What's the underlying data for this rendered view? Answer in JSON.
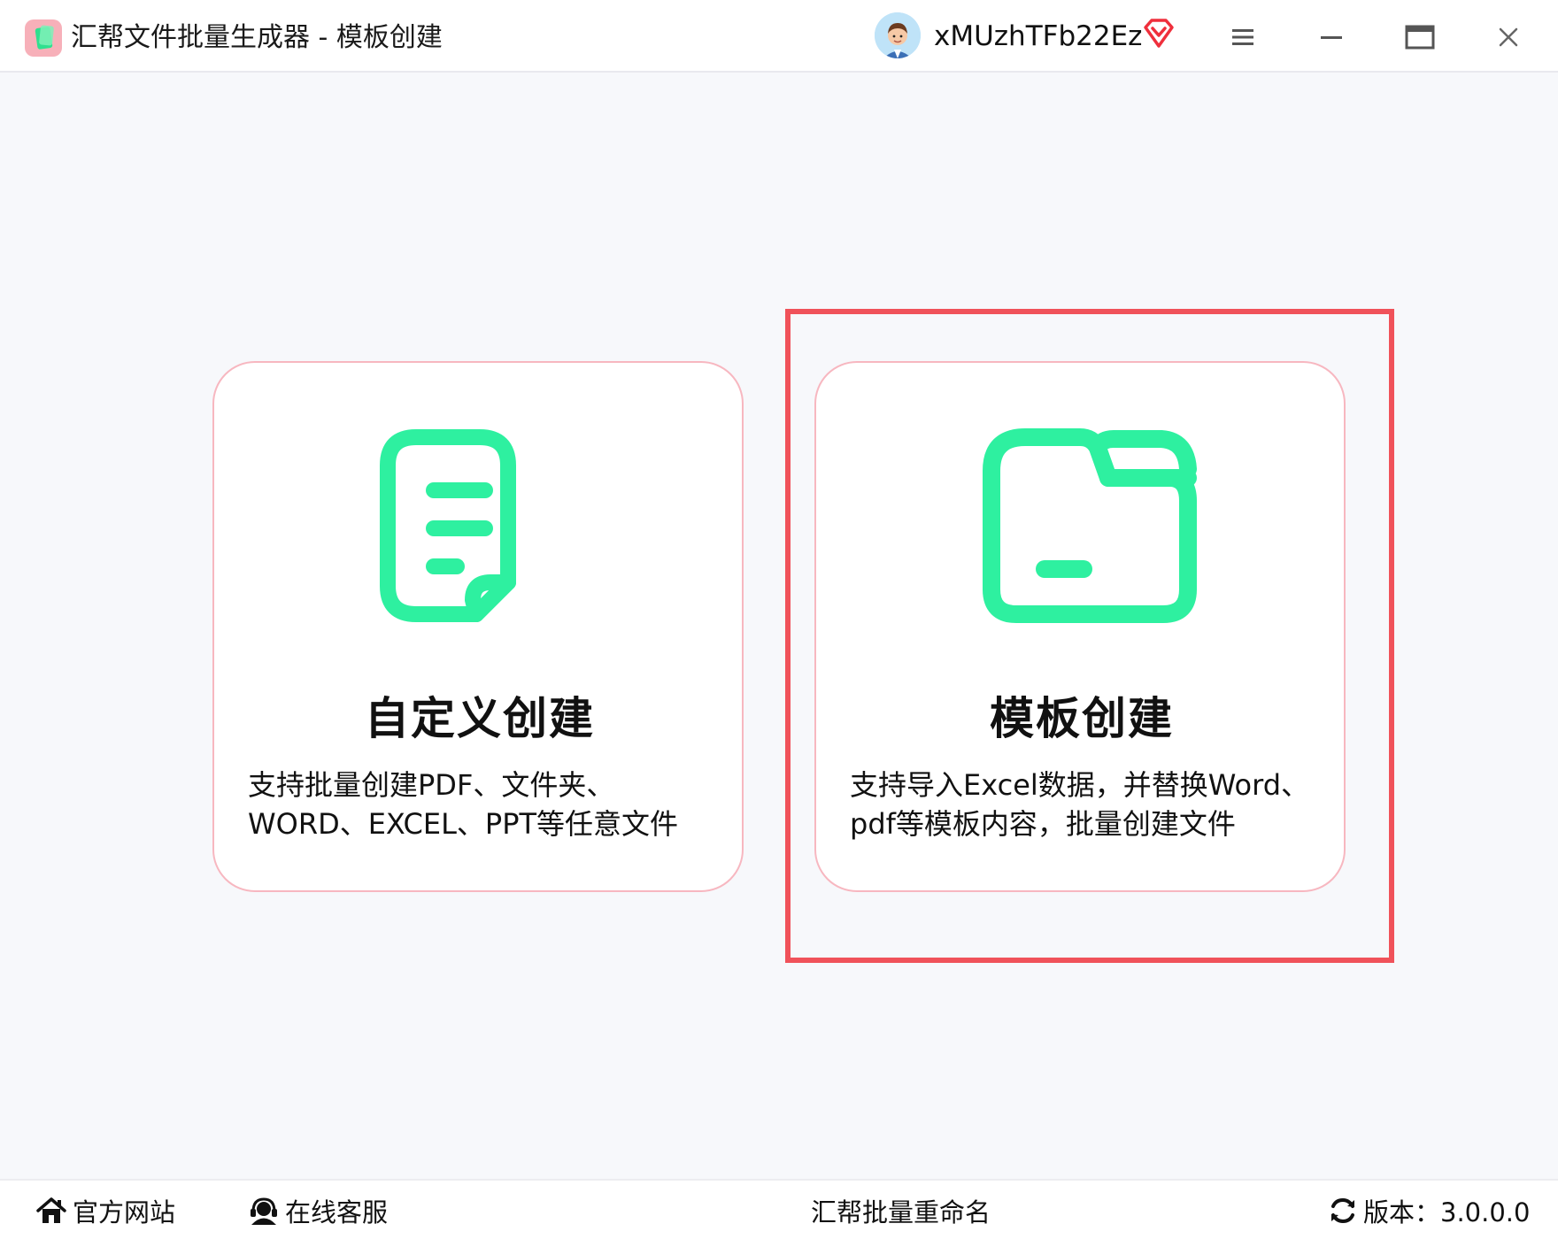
{
  "window": {
    "title": "汇帮文件批量生成器 - 模板创建",
    "app_logo_icon": "app-logo-icon"
  },
  "user": {
    "name": "xMUzhTFb22Ez",
    "avatar_icon": "avatar-icon",
    "vip_icon": "diamond-vip-icon"
  },
  "controls": {
    "menu_icon": "hamburger-menu-icon",
    "minimize_icon": "minimize-icon",
    "maximize_icon": "maximize-icon",
    "close_icon": "close-icon"
  },
  "cards": [
    {
      "title": "自定义创建",
      "description_line1": "支持批量创建PDF、文件夹、",
      "description_line2": "WORD、EXCEL、PPT等任意文件",
      "icon": "document-icon"
    },
    {
      "title": "模板创建",
      "description_line1": "支持导入Excel数据，并替换Word、",
      "description_line2": "pdf等模板内容，批量创建文件",
      "icon": "folder-icon",
      "selected": true
    }
  ],
  "footer": {
    "website_label": "官方网站",
    "service_label": "在线客服",
    "rename_label": "汇帮批量重命名",
    "version_label": "版本：3.0.0.0"
  },
  "colors": {
    "accent_green": "#2ef0a0",
    "card_border": "#f7b7c0",
    "highlight_red": "#f0525a",
    "background": "#f7f8fb"
  }
}
